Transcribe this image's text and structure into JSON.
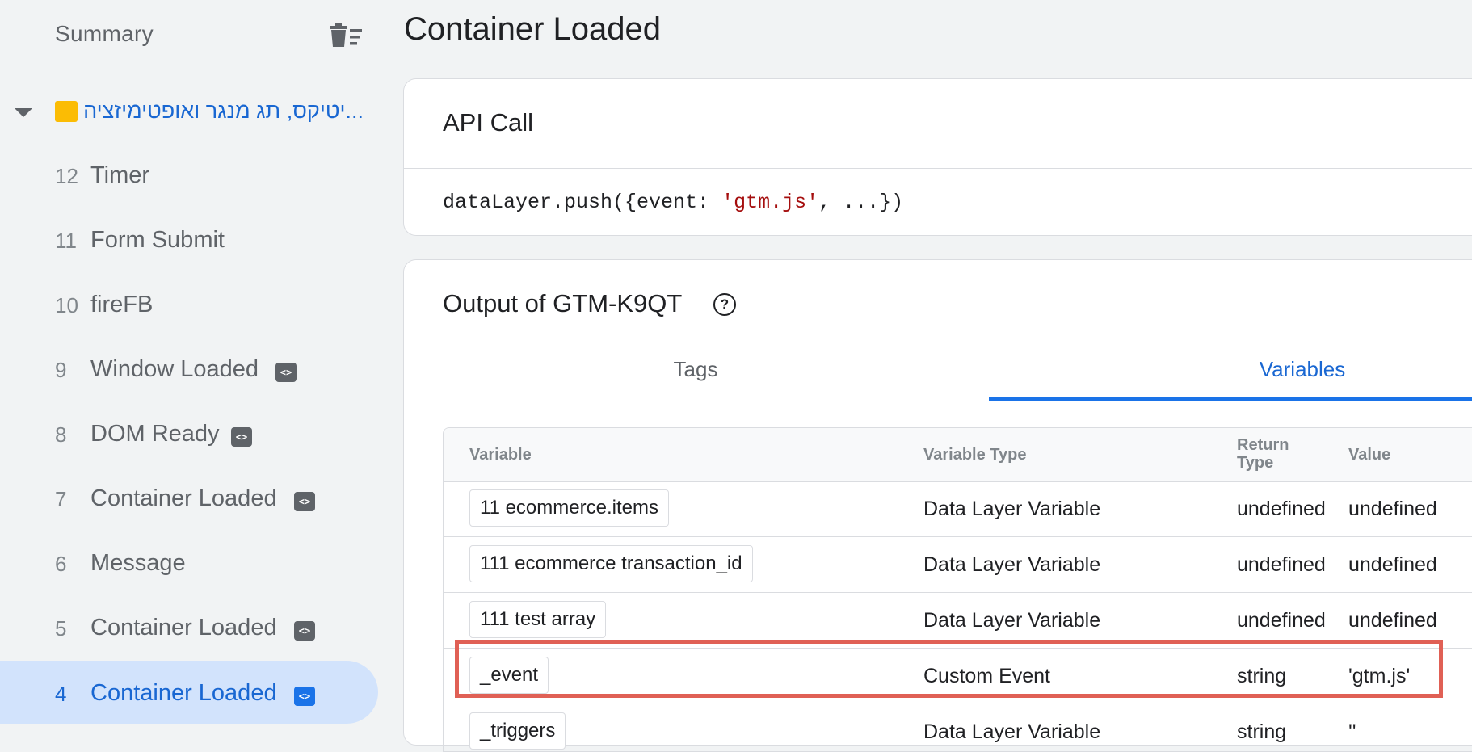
{
  "sidebar": {
    "summary_label": "Summary",
    "group_label": "...יטיקס, תג מנגר ואופטימיזציה",
    "items": [
      {
        "num": "12",
        "label": "Timer",
        "has_code_icon": false
      },
      {
        "num": "11",
        "label": "Form Submit",
        "has_code_icon": false
      },
      {
        "num": "10",
        "label": "fireFB",
        "has_code_icon": false
      },
      {
        "num": "9",
        "label": "Window Loaded",
        "has_code_icon": true
      },
      {
        "num": "8",
        "label": "DOM Ready",
        "has_code_icon": true
      },
      {
        "num": "7",
        "label": "Container Loaded",
        "has_code_icon": true
      },
      {
        "num": "6",
        "label": "Message",
        "has_code_icon": false
      },
      {
        "num": "5",
        "label": "Container Loaded",
        "has_code_icon": true
      },
      {
        "num": "4",
        "label": "Container Loaded",
        "has_code_icon": true,
        "active": true
      }
    ]
  },
  "main": {
    "title": "Container Loaded",
    "api_call": {
      "heading": "API Call",
      "code_prefix": "dataLayer.push({event: ",
      "code_string": "'gtm.js'",
      "code_suffix": ", ...})"
    },
    "output": {
      "heading": "Output of GTM-K9QT",
      "tabs": [
        {
          "label": "Tags",
          "active": false
        },
        {
          "label": "Variables",
          "active": true
        }
      ],
      "table": {
        "headers": {
          "variable": "Variable",
          "type": "Variable Type",
          "return_type_line1": "Return",
          "return_type_line2": "Type",
          "value": "Value"
        },
        "rows": [
          {
            "variable": "11 ecommerce.items",
            "type": "Data Layer Variable",
            "return_type": "undefined",
            "value": "undefined"
          },
          {
            "variable": "111 ecommerce transaction_id",
            "type": "Data Layer Variable",
            "return_type": "undefined",
            "value": "undefined"
          },
          {
            "variable": "111 test array",
            "type": "Data Layer Variable",
            "return_type": "undefined",
            "value": "undefined"
          },
          {
            "variable": "_event",
            "type": "Custom Event",
            "return_type": "string",
            "value": "'gtm.js'",
            "highlighted": true
          },
          {
            "variable": "_triggers",
            "type": "Data Layer Variable",
            "return_type": "string",
            "value": "''"
          }
        ]
      }
    }
  },
  "colors": {
    "accent": "#1a73e8",
    "highlight_border": "#e06055",
    "folder": "#fbbc04"
  }
}
